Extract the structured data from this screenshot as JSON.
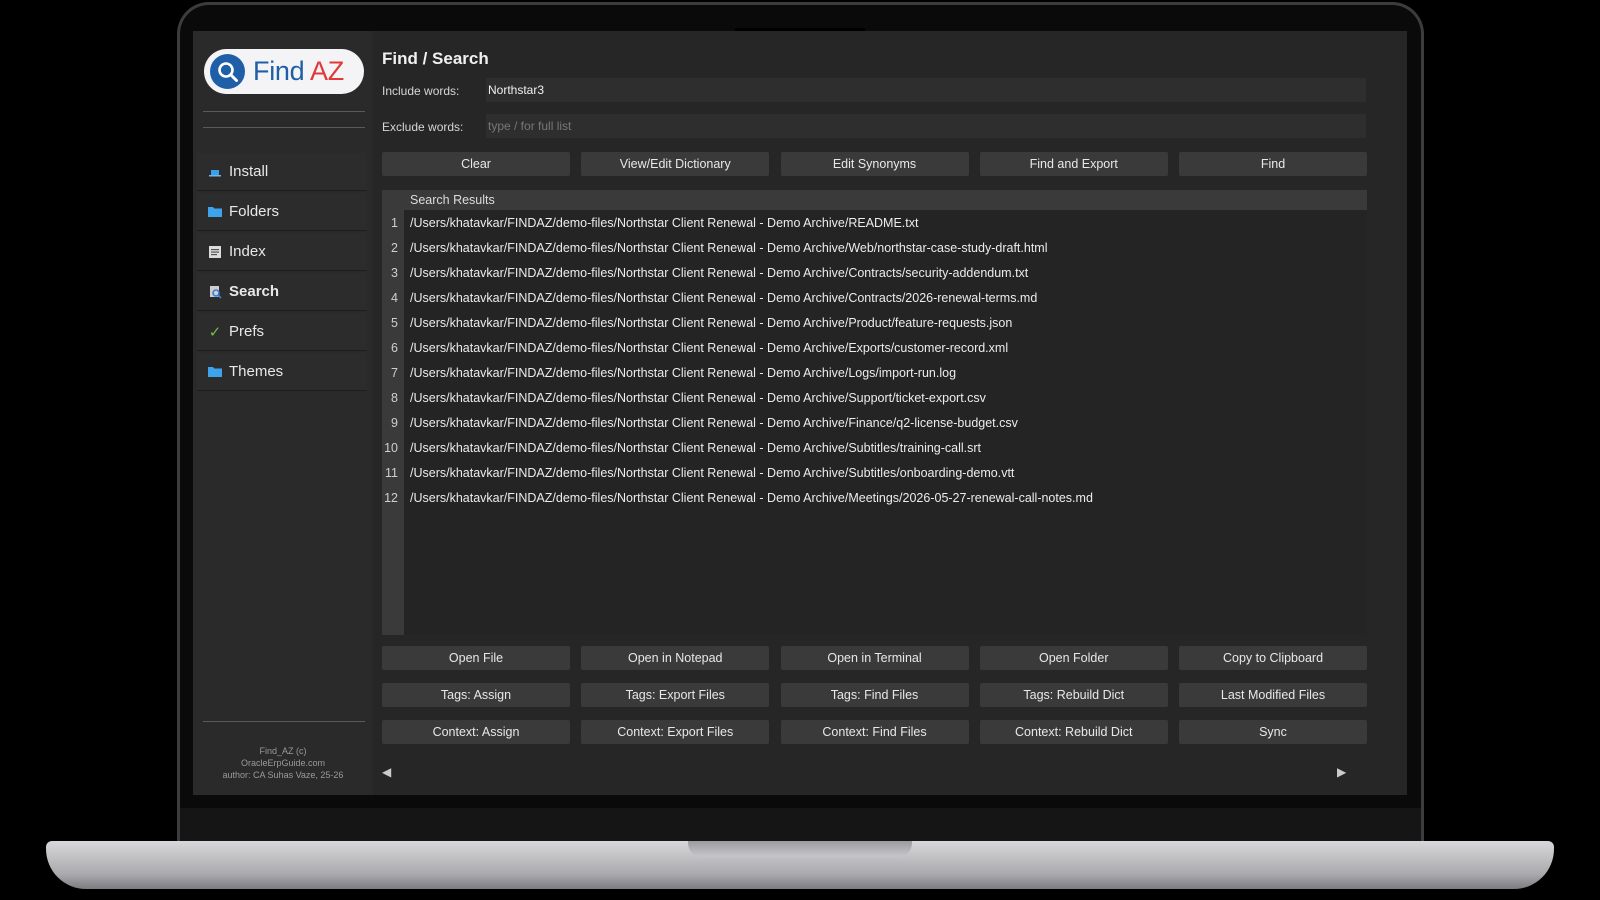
{
  "app": {
    "logo_find": "Find",
    "logo_az": "AZ",
    "title": "Find / Search",
    "footer": [
      "Find_AZ (c)",
      "OracleErpGuide.com",
      "author: CA Suhas Vaze, 25-26"
    ]
  },
  "sidebar": {
    "items": [
      {
        "label": "Install",
        "icon": "laptop-icon"
      },
      {
        "label": "Folders",
        "icon": "folder-icon"
      },
      {
        "label": "Index",
        "icon": "index-icon"
      },
      {
        "label": "Search",
        "icon": "search-icon"
      },
      {
        "label": "Prefs",
        "icon": "checkmark-icon"
      },
      {
        "label": "Themes",
        "icon": "folder-icon"
      }
    ]
  },
  "search": {
    "include_label": "Include words:",
    "include_value": "Northstar3",
    "exclude_label": "Exclude words:",
    "exclude_placeholder": "type / for full list"
  },
  "top_buttons": [
    "Clear",
    "View/Edit Dictionary",
    "Edit Synonyms",
    "Find and Export",
    "Find"
  ],
  "results": {
    "header": "Search Results",
    "rows": [
      {
        "n": "1",
        "path": "/Users/khatavkar/FINDAZ/demo-files/Northstar Client Renewal - Demo Archive/README.txt"
      },
      {
        "n": "2",
        "path": "/Users/khatavkar/FINDAZ/demo-files/Northstar Client Renewal - Demo Archive/Web/northstar-case-study-draft.html"
      },
      {
        "n": "3",
        "path": "/Users/khatavkar/FINDAZ/demo-files/Northstar Client Renewal - Demo Archive/Contracts/security-addendum.txt"
      },
      {
        "n": "4",
        "path": "/Users/khatavkar/FINDAZ/demo-files/Northstar Client Renewal - Demo Archive/Contracts/2026-renewal-terms.md"
      },
      {
        "n": "5",
        "path": "/Users/khatavkar/FINDAZ/demo-files/Northstar Client Renewal - Demo Archive/Product/feature-requests.json"
      },
      {
        "n": "6",
        "path": "/Users/khatavkar/FINDAZ/demo-files/Northstar Client Renewal - Demo Archive/Exports/customer-record.xml"
      },
      {
        "n": "7",
        "path": "/Users/khatavkar/FINDAZ/demo-files/Northstar Client Renewal - Demo Archive/Logs/import-run.log"
      },
      {
        "n": "8",
        "path": "/Users/khatavkar/FINDAZ/demo-files/Northstar Client Renewal - Demo Archive/Support/ticket-export.csv"
      },
      {
        "n": "9",
        "path": "/Users/khatavkar/FINDAZ/demo-files/Northstar Client Renewal - Demo Archive/Finance/q2-license-budget.csv"
      },
      {
        "n": "10",
        "path": "/Users/khatavkar/FINDAZ/demo-files/Northstar Client Renewal - Demo Archive/Subtitles/training-call.srt"
      },
      {
        "n": "11",
        "path": "/Users/khatavkar/FINDAZ/demo-files/Northstar Client Renewal - Demo Archive/Subtitles/onboarding-demo.vtt"
      },
      {
        "n": "12",
        "path": "/Users/khatavkar/FINDAZ/demo-files/Northstar Client Renewal - Demo Archive/Meetings/2026-05-27-renewal-call-notes.md"
      }
    ]
  },
  "action_rows": [
    [
      "Open File",
      "Open in Notepad",
      "Open in Terminal",
      "Open Folder",
      "Copy to Clipboard"
    ],
    [
      "Tags: Assign",
      "Tags: Export Files",
      "Tags: Find Files",
      "Tags: Rebuild Dict",
      "Last Modified Files"
    ],
    [
      "Context: Assign",
      "Context: Export Files",
      "Context: Find Files",
      "Context: Rebuild Dict",
      "Sync"
    ]
  ],
  "scroll": {
    "left": "◀",
    "right": "▶"
  },
  "colors": {
    "brand_blue": "#1f5fa8",
    "brand_red": "#e23838",
    "background": "#262626",
    "button": "#3a3a3a"
  }
}
